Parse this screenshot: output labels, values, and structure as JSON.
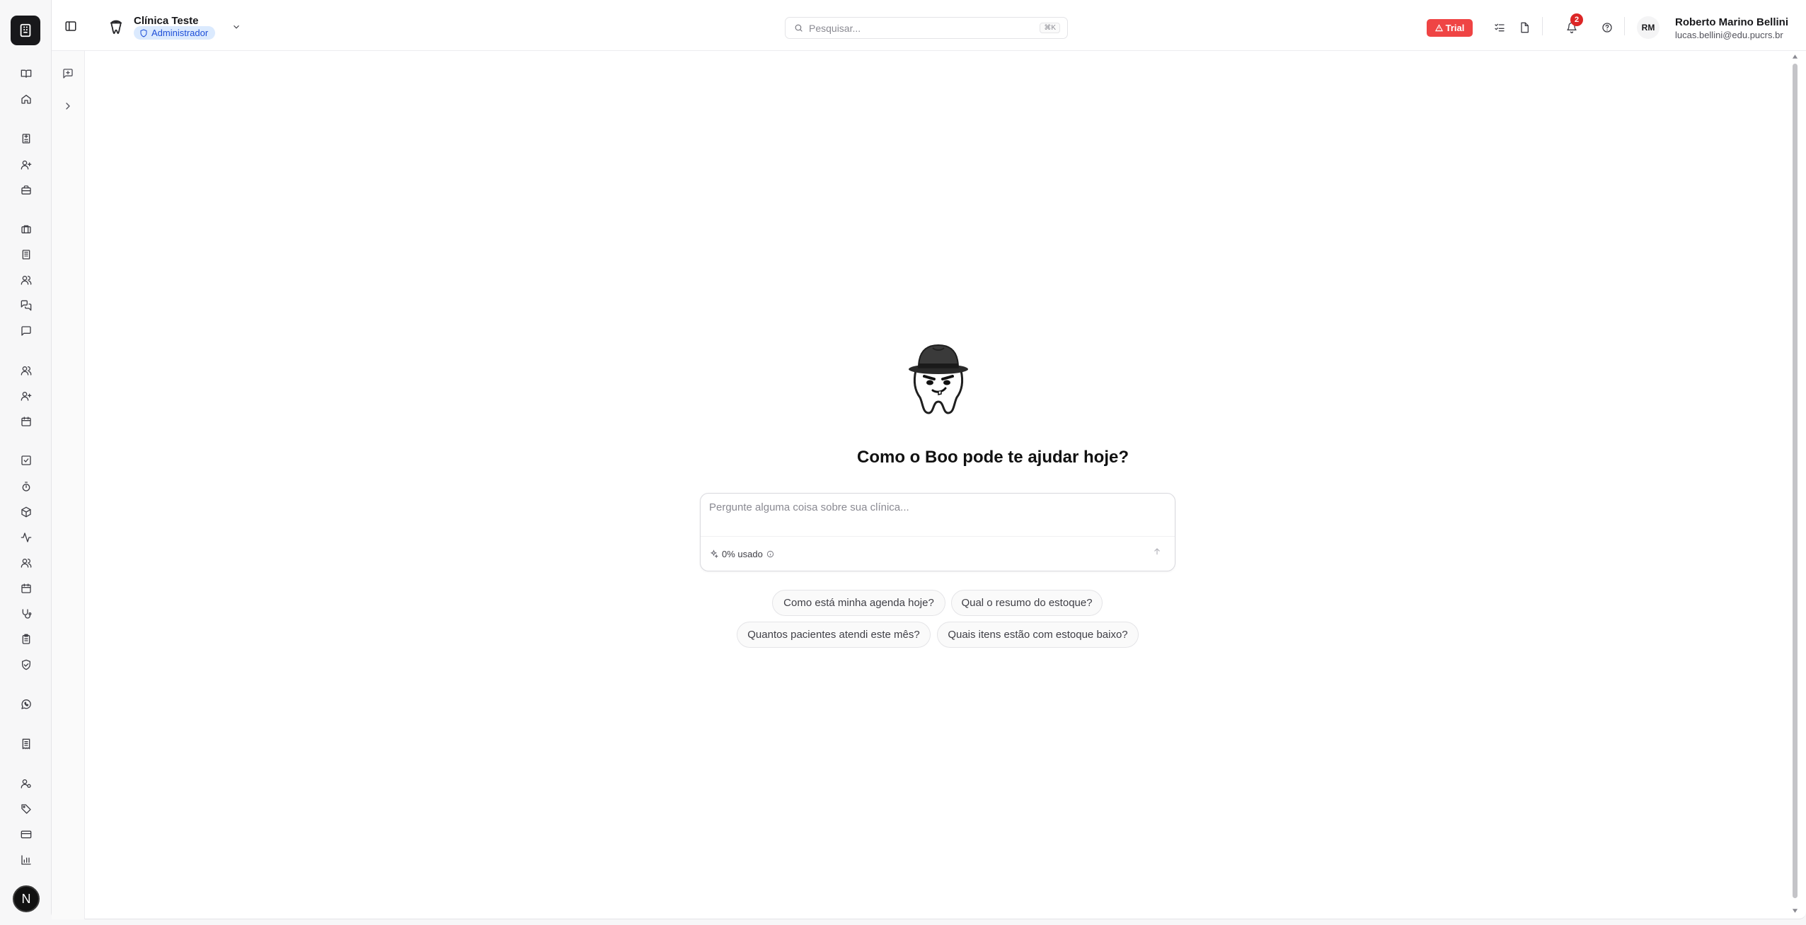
{
  "clinic": {
    "name": "Clínica Teste",
    "role": "Administrador"
  },
  "search": {
    "placeholder": "Pesquisar...",
    "shortcut": "⌘K"
  },
  "header": {
    "trial_label": "Trial",
    "notification_count": "2",
    "user_initials": "RM",
    "user_name": "Roberto Marino Bellini",
    "user_email": "lucas.bellini@edu.pucrs.br"
  },
  "assistant": {
    "greeting": "Como o Boo pode te ajudar hoje?",
    "input_placeholder": "Pergunte alguma coisa sobre sua clínica...",
    "usage_label": "0% usado"
  },
  "suggestions": [
    "Como está minha agenda hoje?",
    "Qual o resumo do estoque?",
    "Quantos pacientes atendi este mês?",
    "Quais itens estão com estoque baixo?"
  ],
  "rail": {
    "avatar_letter": "N"
  },
  "colors": {
    "trial": "#ef4444",
    "notification": "#dc2626",
    "role_badge_bg": "#dbeafe",
    "role_badge_text": "#1d4ed8"
  }
}
